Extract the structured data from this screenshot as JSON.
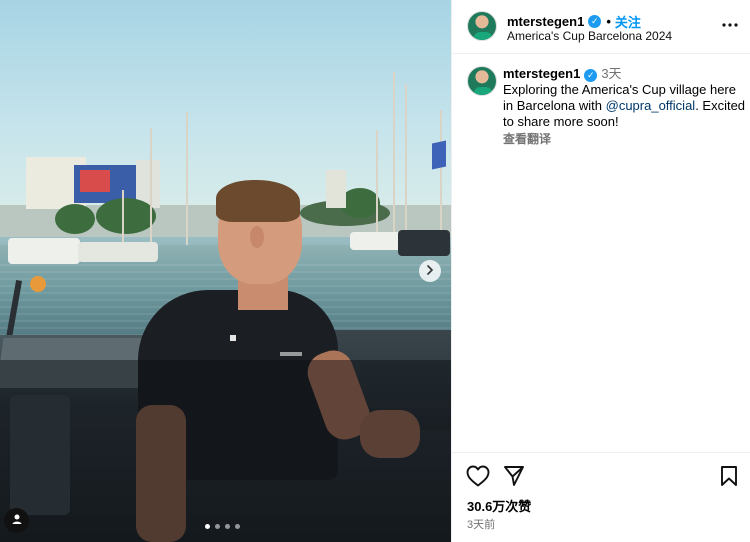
{
  "post": {
    "username": "mterstegen1",
    "verified": true,
    "follow_label": "关注",
    "separator": "•",
    "location": "America's Cup Barcelona 2024",
    "more_label": "•••"
  },
  "caption": {
    "username": "mterstegen1",
    "time": "3天",
    "text_before": "Exploring the America's Cup village here in Barcelona with ",
    "mention": "@cupra_official",
    "text_after": ". Excited to share more soon!",
    "translate_label": "查看翻译"
  },
  "engagement": {
    "likes": "30.6万次赞",
    "posted_ago": "3天前"
  },
  "media": {
    "next_icon": "chevron-right-icon",
    "tag_icon": "user-tag-icon",
    "carousel_dots": 4,
    "active_dot": 0
  },
  "icons": {
    "like": "heart-icon",
    "share": "paper-plane-icon",
    "save": "bookmark-icon"
  },
  "colors": {
    "accent": "#0095f6",
    "verified": "#1d9bf0",
    "muted": "#737373",
    "mention": "#00376b"
  }
}
